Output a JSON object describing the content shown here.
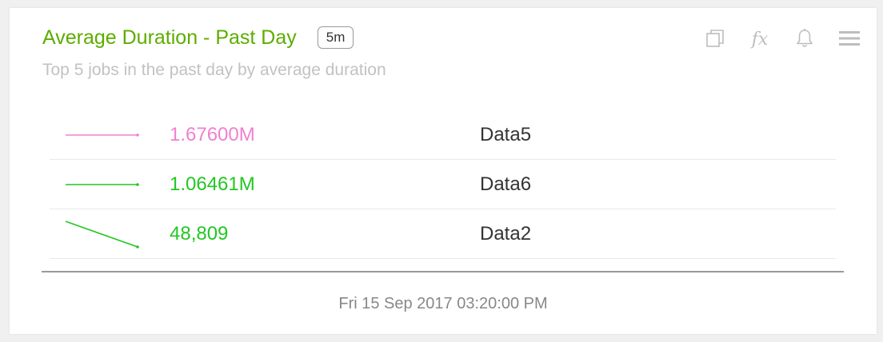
{
  "widget": {
    "title": "Average Duration - Past Day",
    "interval_badge": "5m",
    "subtitle": "Top 5 jobs in the past day by average duration",
    "toolbar": [
      {
        "icon": "copy-icon"
      },
      {
        "icon": "function-icon",
        "glyph": "fx"
      },
      {
        "icon": "bell-icon"
      },
      {
        "icon": "hamburger-menu-icon"
      }
    ]
  },
  "rows": [
    {
      "value": "1.67600M",
      "name": "Data5",
      "color": "#f080d0",
      "trend": "flat"
    },
    {
      "value": "1.06461M",
      "name": "Data6",
      "color": "#22c722",
      "trend": "flat"
    },
    {
      "value": "48,809",
      "name": "Data2",
      "color": "#22c722",
      "trend": "down"
    }
  ],
  "footer": {
    "timestamp": "Fri 15 Sep 2017 03:20:00 PM"
  },
  "colors": {
    "title": "#5cad00",
    "subtitle": "#c2c2c2",
    "icon": "#bdbdbd",
    "divider": "#999999"
  }
}
